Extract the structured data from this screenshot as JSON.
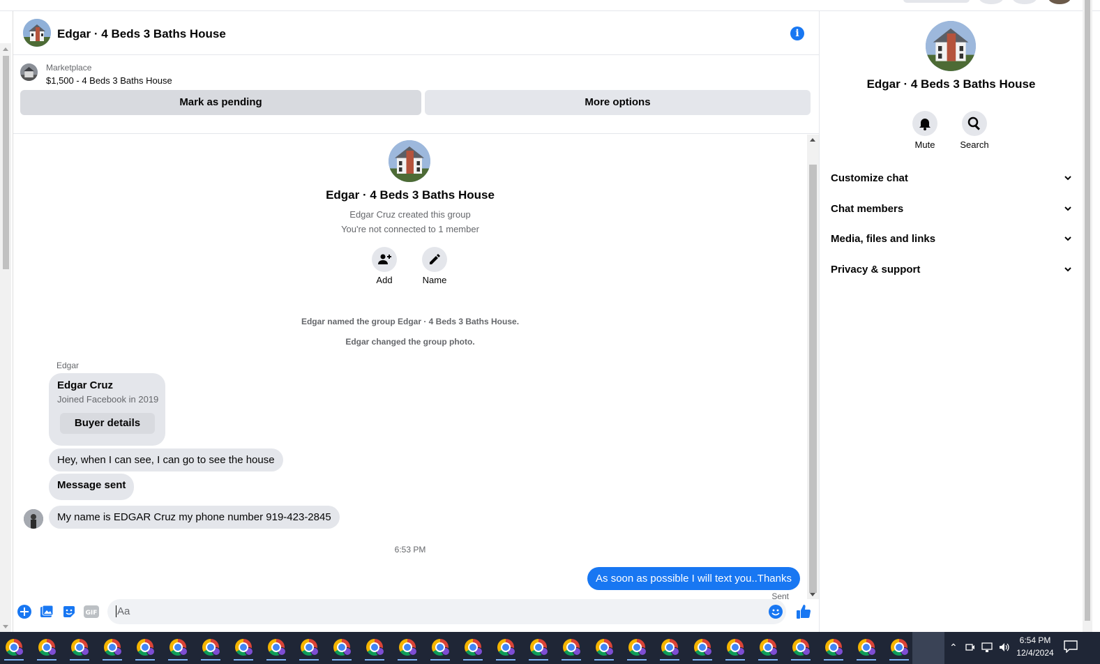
{
  "header": {
    "title": "Edgar · 4 Beds 3 Baths House",
    "info_icon": "info-icon"
  },
  "marketplace": {
    "label": "Marketplace",
    "listing": "$1,500 - 4 Beds 3 Baths House",
    "mark_pending": "Mark as pending",
    "more_options": "More options"
  },
  "intro": {
    "title": "Edgar · 4 Beds 3 Baths House",
    "created": "Edgar Cruz created this group",
    "connected": "You're not connected to 1 member",
    "add_label": "Add",
    "name_label": "Name"
  },
  "events": [
    "Edgar named the group Edgar · 4 Beds 3 Baths House.",
    "Edgar changed the group photo."
  ],
  "sender_label": "Edgar",
  "profile_card": {
    "name": "Edgar Cruz",
    "joined": "Joined Facebook in 2019",
    "button": "Buyer details"
  },
  "messages": {
    "m1": "Hey, when I can see, I can go to see the house",
    "m2": "Message sent",
    "m3": "My name is EDGAR Cruz my phone number 919-423-2845",
    "time": "6:53 PM",
    "m4": "As soon as possible I will text you..Thanks",
    "status": "Sent"
  },
  "composer": {
    "placeholder": "Aa"
  },
  "right_panel": {
    "title": "Edgar · 4 Beds 3 Baths House",
    "mute": "Mute",
    "search": "Search",
    "sections": [
      "Customize chat",
      "Chat members",
      "Media, files and links",
      "Privacy & support"
    ]
  },
  "taskbar": {
    "time": "6:54 PM",
    "date": "12/4/2024"
  },
  "colors": {
    "accent": "#1877f2",
    "bubble_gray": "#e4e6eb",
    "taskbar": "#1f2636"
  }
}
